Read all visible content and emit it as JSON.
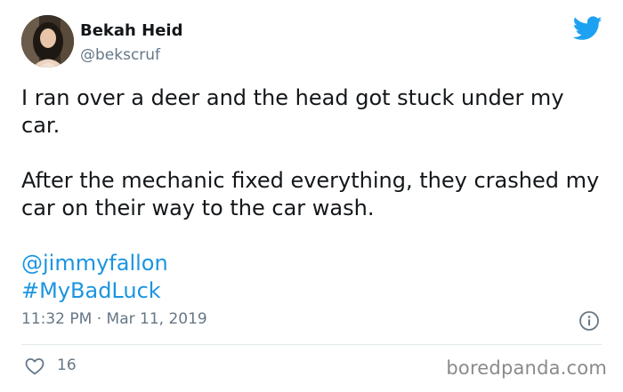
{
  "author": {
    "name": "Bekah Heid",
    "handle": "@bekscruf"
  },
  "icons": {
    "brand": "twitter-bird-icon",
    "info": "info-icon",
    "like": "heart-icon"
  },
  "colors": {
    "link": "#1b95e0",
    "brand": "#1da1f2",
    "muted": "#657786"
  },
  "tweet": {
    "line1": "I ran over a deer and the head got stuck under my car.",
    "line2": "After the mechanic fixed everything, they crashed my car on their way to the car wash.",
    "mention": "@jimmyfallon",
    "hashtag": "#MyBadLuck",
    "timestamp": "11:32 PM · Mar 11, 2019"
  },
  "stats": {
    "likes": "16"
  },
  "watermark": "boredpanda.com"
}
